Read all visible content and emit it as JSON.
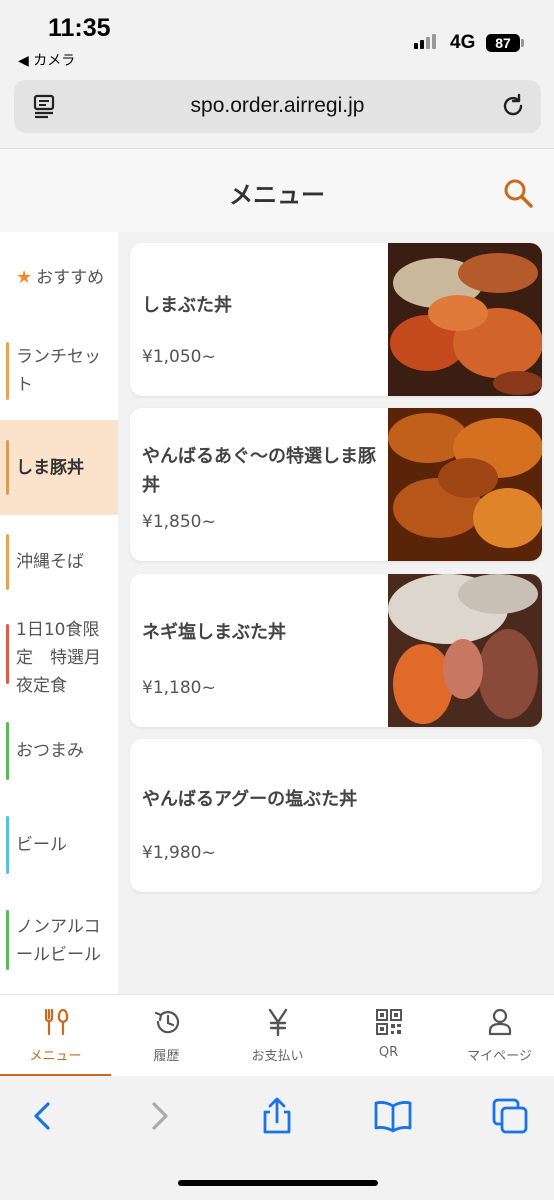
{
  "status_bar": {
    "time": "11:35",
    "back_app": "◀ カメラ",
    "network": "4G",
    "battery": "87"
  },
  "browser": {
    "url": "spo.order.airregi.jp"
  },
  "header": {
    "title": "メニュー"
  },
  "categories": [
    {
      "label": "おすすめ",
      "icon": "star-icon",
      "accent": "#f08c2b"
    },
    {
      "label": "ランチセット",
      "accent": "#e8a25a"
    },
    {
      "label": "しま豚丼",
      "accent": "#d99a5c",
      "active": true
    },
    {
      "label": "沖縄そば",
      "accent": "#e8a25a"
    },
    {
      "label": "1日10食限定　特選月夜定食",
      "accent": "#e05a4a"
    },
    {
      "label": "おつまみ",
      "accent": "#5cb85c"
    },
    {
      "label": "ビール",
      "accent": "#5bc0de"
    },
    {
      "label": "ノンアルコールビール",
      "accent": "#5cb85c"
    }
  ],
  "menu_items": [
    {
      "name": "しまぶた丼",
      "price": "¥1,050~",
      "has_photo": true
    },
    {
      "name": "やんばるあぐ〜の特選しま豚丼",
      "price": "¥1,850~",
      "has_photo": true
    },
    {
      "name": "ネギ塩しまぶた丼",
      "price": "¥1,180~",
      "has_photo": true
    },
    {
      "name": "やんばるアグーの塩ぶた丼",
      "price": "¥1,980~",
      "has_photo": false
    }
  ],
  "tabs": [
    {
      "label": "メニュー",
      "icon": "fork-knife-icon",
      "active": true
    },
    {
      "label": "履歴",
      "icon": "history-icon"
    },
    {
      "label": "お支払い",
      "icon": "yen-icon"
    },
    {
      "label": "QR",
      "icon": "qr-code-icon"
    },
    {
      "label": "マイページ",
      "icon": "person-icon"
    }
  ],
  "colors": {
    "accent": "#c96a1e",
    "active_category_bg": "#fbe3cb"
  }
}
